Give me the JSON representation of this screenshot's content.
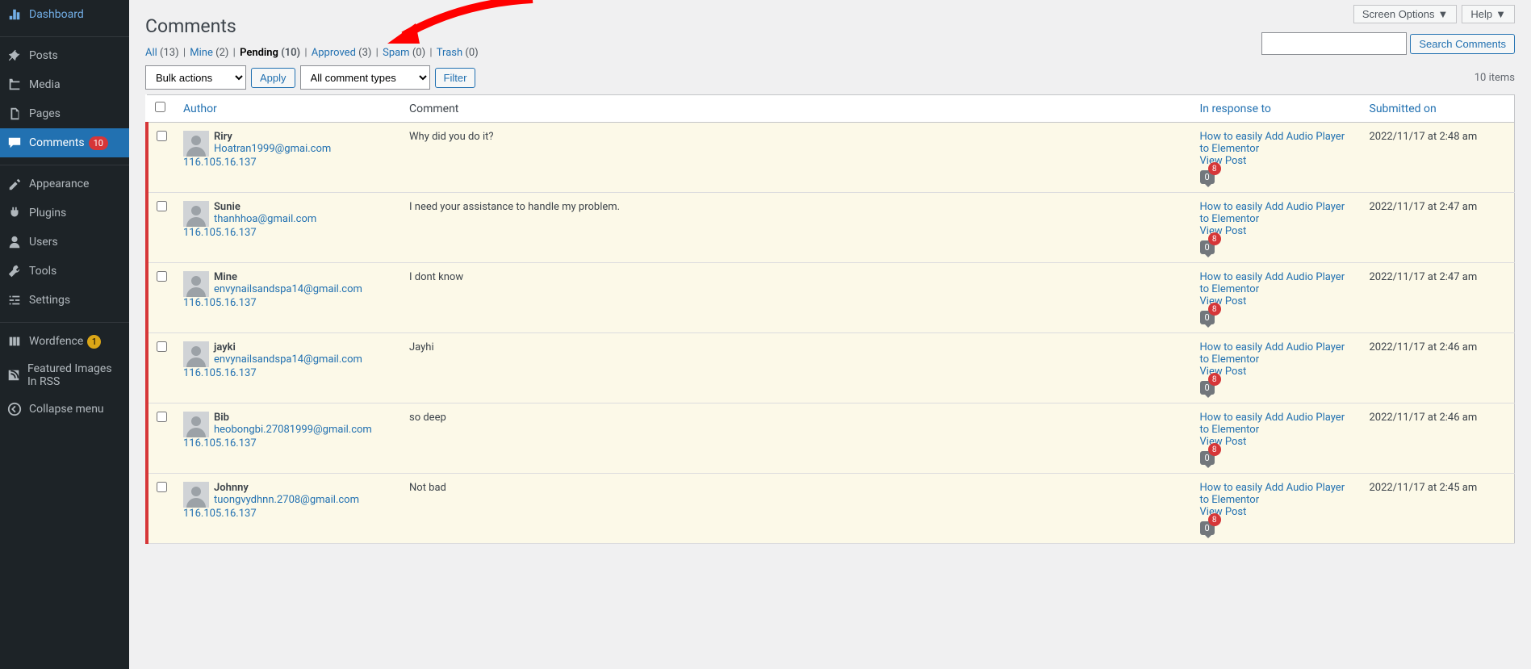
{
  "header": {
    "title": "Comments",
    "screen_options": "Screen Options",
    "help": "Help"
  },
  "sidebar": {
    "items": [
      {
        "label": "Dashboard",
        "icon": "dashboard"
      },
      {
        "label": "Posts",
        "icon": "pin"
      },
      {
        "label": "Media",
        "icon": "media"
      },
      {
        "label": "Pages",
        "icon": "pages"
      },
      {
        "label": "Comments",
        "icon": "comments",
        "badge": "10",
        "active": true
      },
      {
        "label": "Appearance",
        "icon": "appearance"
      },
      {
        "label": "Plugins",
        "icon": "plugins"
      },
      {
        "label": "Users",
        "icon": "users"
      },
      {
        "label": "Tools",
        "icon": "tools"
      },
      {
        "label": "Settings",
        "icon": "settings"
      },
      {
        "label": "Wordfence",
        "icon": "wordfence",
        "badge_yellow": "1"
      },
      {
        "label": "Featured Images In RSS",
        "icon": "rss"
      },
      {
        "label": "Collapse menu",
        "icon": "collapse"
      }
    ]
  },
  "filters": {
    "all_label": "All",
    "all_count": "(13)",
    "mine_label": "Mine",
    "mine_count": "(2)",
    "pending_label": "Pending",
    "pending_count": "(10)",
    "approved_label": "Approved",
    "approved_count": "(3)",
    "spam_label": "Spam",
    "spam_count": "(0)",
    "trash_label": "Trash",
    "trash_count": "(0)"
  },
  "search": {
    "button": "Search Comments"
  },
  "actions": {
    "bulk_actions": "Bulk actions",
    "apply": "Apply",
    "comment_types": "All comment types",
    "filter": "Filter",
    "items_count": "10 items"
  },
  "columns": {
    "author": "Author",
    "comment": "Comment",
    "response": "In response to",
    "submitted": "Submitted on"
  },
  "response_post": {
    "title": "How to easily Add Audio Player to Elementor",
    "view_post": "View Post",
    "count": "0",
    "pending": "8"
  },
  "comments": [
    {
      "author": "Riry",
      "email": "Hoatran1999@gmai.com",
      "ip": "116.105.16.137",
      "text": "Why did you do it?",
      "date": "2022/11/17 at 2:48 am"
    },
    {
      "author": "Sunie",
      "email": "thanhhoa@gmail.com",
      "ip": "116.105.16.137",
      "text": "I need your assistance to handle my problem.",
      "date": "2022/11/17 at 2:47 am"
    },
    {
      "author": "Mine",
      "email": "envynailsandspa14@gmail.com",
      "ip": "116.105.16.137",
      "text": "I dont know",
      "date": "2022/11/17 at 2:47 am"
    },
    {
      "author": "jayki",
      "email": "envynailsandspa14@gmail.com",
      "ip": "116.105.16.137",
      "text": "Jayhi",
      "date": "2022/11/17 at 2:46 am"
    },
    {
      "author": "Bib",
      "email": "heobongbi.27081999@gmail.com",
      "ip": "116.105.16.137",
      "text": "so deep",
      "date": "2022/11/17 at 2:46 am"
    },
    {
      "author": "Johnny",
      "email": "tuongvydhnn.2708@gmail.com",
      "ip": "116.105.16.137",
      "text": "Not bad",
      "date": "2022/11/17 at 2:45 am"
    }
  ]
}
